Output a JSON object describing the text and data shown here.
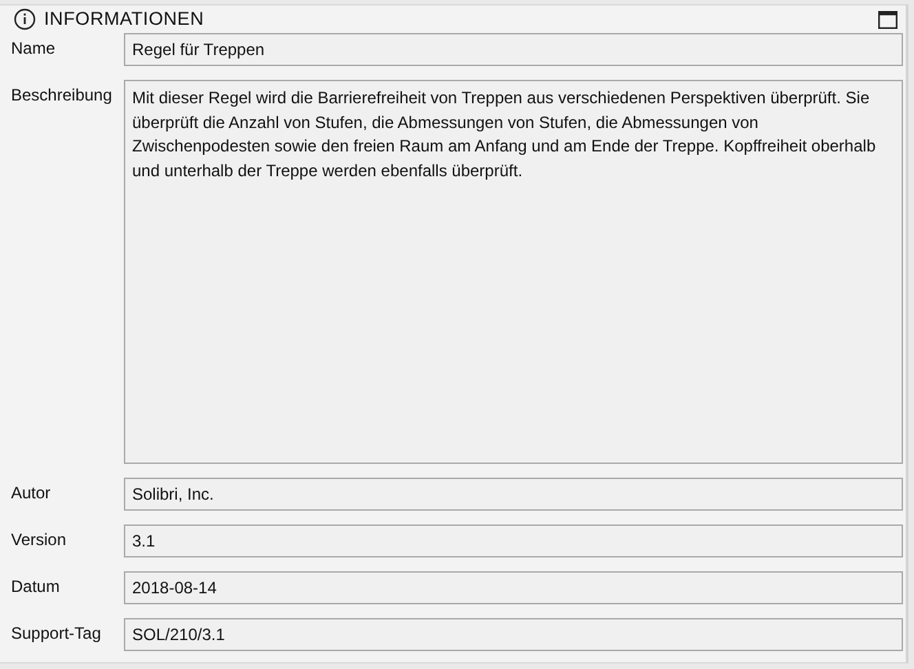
{
  "panel": {
    "title": "INFORMATIONEN"
  },
  "fields": [
    {
      "label": "Name",
      "value": "Regel für Treppen",
      "kind": "line"
    },
    {
      "label": "Beschreibung",
      "value": "Mit dieser Regel wird die Barrierefreiheit von Treppen aus verschiedenen Perspektiven überprüft. Sie überprüft die Anzahl von Stufen, die Abmessungen von Stufen, die Abmessungen von Zwischenpodesten sowie den freien Raum am Anfang und am Ende der Treppe. Kopffreiheit oberhalb und unterhalb der Treppe werden ebenfalls überprüft.",
      "kind": "area"
    },
    {
      "label": "Autor",
      "value": "Solibri, Inc.",
      "kind": "line"
    },
    {
      "label": "Version",
      "value": "3.1",
      "kind": "line"
    },
    {
      "label": "Datum",
      "value": "2018-08-14",
      "kind": "line"
    },
    {
      "label": "Support-Tag",
      "value": "SOL/210/3.1",
      "kind": "line"
    }
  ]
}
